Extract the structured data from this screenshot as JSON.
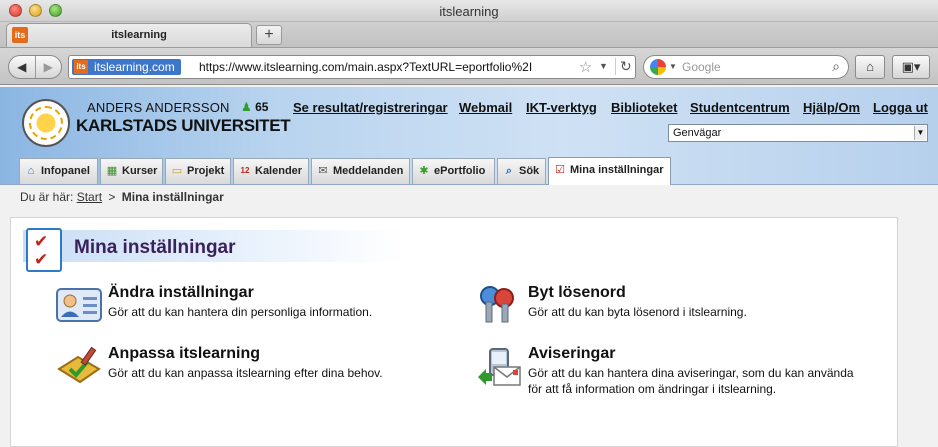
{
  "browser": {
    "window_title": "itslearning",
    "tab_title": "itslearning",
    "favicon_text": "its",
    "new_tab_label": "+",
    "back_label": "◀",
    "forward_label": "▶",
    "site_identity": "itslearning.com",
    "url": "https://www.itslearning.com/main.aspx?TextURL=eportfolio%2I",
    "search_placeholder": "Google"
  },
  "header": {
    "user_name": "ANDERS ANDERSSON",
    "university": "KARLSTADS UNIVERSITET",
    "online_count": "65",
    "links": [
      "Se resultat/registreringar",
      "Webmail",
      "IKT-verktyg",
      "Biblioteket",
      "Studentcentrum",
      "Hjälp/Om",
      "Logga ut"
    ],
    "shortcut_value": "Genvägar"
  },
  "nav_tabs": [
    "Infopanel",
    "Kurser",
    "Projekt",
    "Kalender",
    "Meddelanden",
    "ePortfolio",
    "Sök",
    "Mina inställningar"
  ],
  "breadcrumb": {
    "prefix": "Du är här:",
    "start": "Start",
    "separator": ">",
    "current": "Mina inställningar"
  },
  "main": {
    "title": "Mina inställningar",
    "options": [
      {
        "title": "Ändra inställningar",
        "desc": "Gör att du kan hantera din personliga information."
      },
      {
        "title": "Byt lösenord",
        "desc": "Gör att du kan byta lösenord i itslearning."
      },
      {
        "title": "Anpassa itslearning",
        "desc": "Gör att du kan anpassa itslearning efter dina behov."
      },
      {
        "title": "Aviseringar",
        "desc": "Gör att du kan hantera dina aviseringar, som du kan använda för att få information om ändringar i itslearning."
      }
    ]
  },
  "colors": {
    "accent_orange": "#e36b1a",
    "header_blue": "#b9d4ef",
    "title_purple": "#3b215c"
  }
}
